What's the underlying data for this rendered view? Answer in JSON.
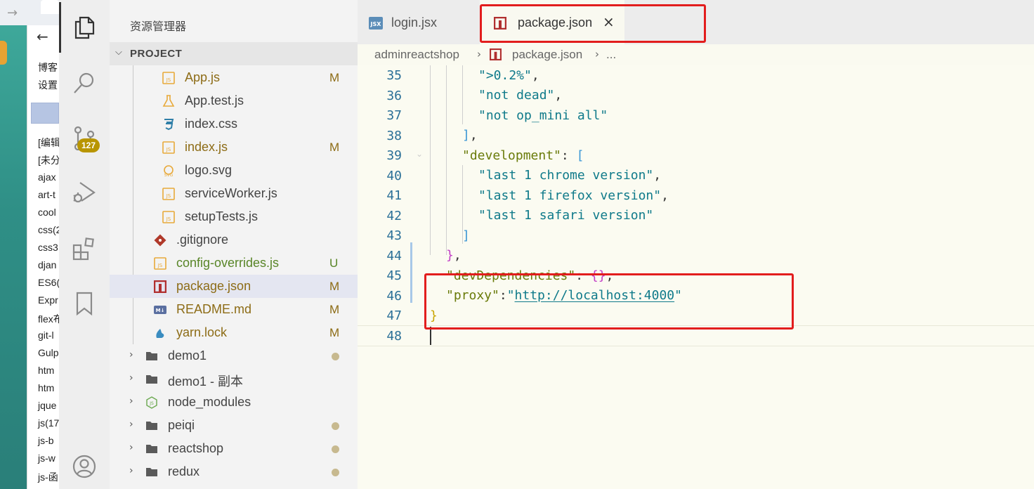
{
  "background_browser": {
    "sidebar_texts": [
      "博客",
      "设置",
      "[编辑",
      "[未分",
      "ajax",
      "art-t",
      "cool",
      "css(2",
      "css3",
      "djan",
      "ES6(",
      "Expr",
      "flex布",
      "git-l",
      "Gulp",
      "htm",
      "htm",
      "jque",
      "js(17",
      "js-b",
      "js-w",
      "js-函"
    ]
  },
  "activity_bar": {
    "items": [
      {
        "name": "explorer",
        "icon": "files-icon"
      },
      {
        "name": "search",
        "icon": "search-icon"
      },
      {
        "name": "source-control",
        "icon": "source-control-icon",
        "badge": "127"
      },
      {
        "name": "run-debug",
        "icon": "debug-icon"
      },
      {
        "name": "extensions",
        "icon": "extensions-icon"
      },
      {
        "name": "bookmarks",
        "icon": "bookmark-icon"
      },
      {
        "name": "accounts",
        "icon": "account-icon"
      }
    ]
  },
  "explorer": {
    "title": "资源管理器",
    "section": "PROJECT",
    "items": [
      {
        "label": "App.js",
        "status": "M",
        "type": "js"
      },
      {
        "label": "App.test.js",
        "status": "",
        "type": "test"
      },
      {
        "label": "index.css",
        "status": "",
        "type": "css"
      },
      {
        "label": "index.js",
        "status": "M",
        "type": "js"
      },
      {
        "label": "logo.svg",
        "status": "",
        "type": "svg"
      },
      {
        "label": "serviceWorker.js",
        "status": "",
        "type": "js"
      },
      {
        "label": "setupTests.js",
        "status": "",
        "type": "js"
      },
      {
        "label": ".gitignore",
        "status": "",
        "type": "git"
      },
      {
        "label": "config-overrides.js",
        "status": "U",
        "type": "js"
      },
      {
        "label": "package.json",
        "status": "M",
        "type": "npm"
      },
      {
        "label": "README.md",
        "status": "M",
        "type": "md"
      },
      {
        "label": "yarn.lock",
        "status": "M",
        "type": "yarn"
      },
      {
        "label": "demo1",
        "status": "dot",
        "type": "folder"
      },
      {
        "label": "demo1 - 副本",
        "status": "",
        "type": "folder"
      },
      {
        "label": "node_modules",
        "status": "",
        "type": "node"
      },
      {
        "label": "peiqi",
        "status": "dot",
        "type": "folder"
      },
      {
        "label": "reactshop",
        "status": "dot",
        "type": "folder"
      },
      {
        "label": "redux",
        "status": "dot",
        "type": "folder"
      }
    ]
  },
  "editor": {
    "tabs": [
      {
        "label": "login.jsx",
        "icon_text": "JSX",
        "active": false
      },
      {
        "label": "package.json",
        "active": true,
        "close": "×"
      }
    ],
    "breadcrumb": [
      "adminreactshop",
      "package.json",
      "..."
    ],
    "line_numbers": [
      "35",
      "36",
      "37",
      "38",
      "39",
      "40",
      "41",
      "42",
      "43",
      "44",
      "45",
      "46",
      "47",
      "48"
    ],
    "lines": {
      "l35": "\">0.2%\"",
      "l36": "\"not dead\"",
      "l37": "\"not op_mini all\"",
      "l38": "]",
      "l39_key": "\"development\"",
      "l40": "\"last 1 chrome version\"",
      "l41": "\"last 1 firefox version\"",
      "l42": "\"last 1 safari version\"",
      "l43": "]",
      "l44": "}",
      "l45_key": "\"devDependencies\"",
      "l45_val": "{}",
      "l46_key": "\"proxy\"",
      "l46_q": "\"",
      "l46_url": "http://localhost:4000",
      "l47": "}",
      "comma": ",",
      "colon": ": ",
      "colon_tight": ":",
      "open_bracket": "["
    }
  },
  "colors": {
    "annotation": "#e21d1d",
    "scm_badge": "#b89500",
    "modified": "#8d6c16",
    "untracked": "#588527"
  }
}
